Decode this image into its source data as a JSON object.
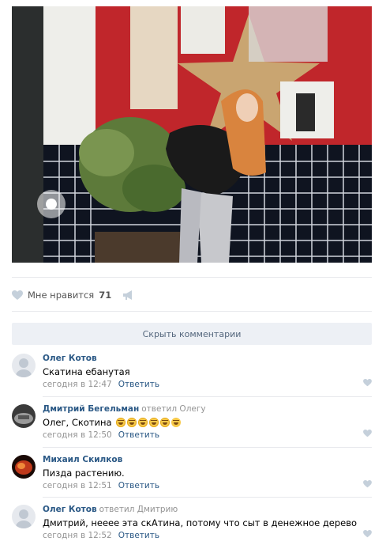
{
  "post": {
    "likes_label": "Мне нравится",
    "likes_count": "71",
    "hide_comments_label": "Скрыть комментарии"
  },
  "comments": [
    {
      "author": "Олег Котов",
      "reply": "",
      "text": "Скатина ебанутая",
      "time": "сегодня в 12:47",
      "action": "Ответить"
    },
    {
      "author": "Дмитрий Бегельман",
      "reply": "ответил Олегу",
      "text": "Олег, Скотина",
      "time": "сегодня в 12:50",
      "action": "Ответить"
    },
    {
      "author": "Михаил Скилков",
      "reply": "",
      "text": "Пизда растению.",
      "time": "сегодня в 12:51",
      "action": "Ответить"
    },
    {
      "author": "Олег Котов",
      "reply": "ответил Дмитрию",
      "text": "Дмитрий, нееее эта скАтина, потому что сыт в денежное дерево",
      "time": "сегодня в 12:52",
      "action": "Ответить"
    }
  ],
  "icons": {
    "like": "heart-icon",
    "share": "megaphone-icon",
    "emoji": "laughing-emoji"
  },
  "colors": {
    "link": "#2a5885",
    "muted": "#939393",
    "button_bg": "#edf0f5"
  }
}
